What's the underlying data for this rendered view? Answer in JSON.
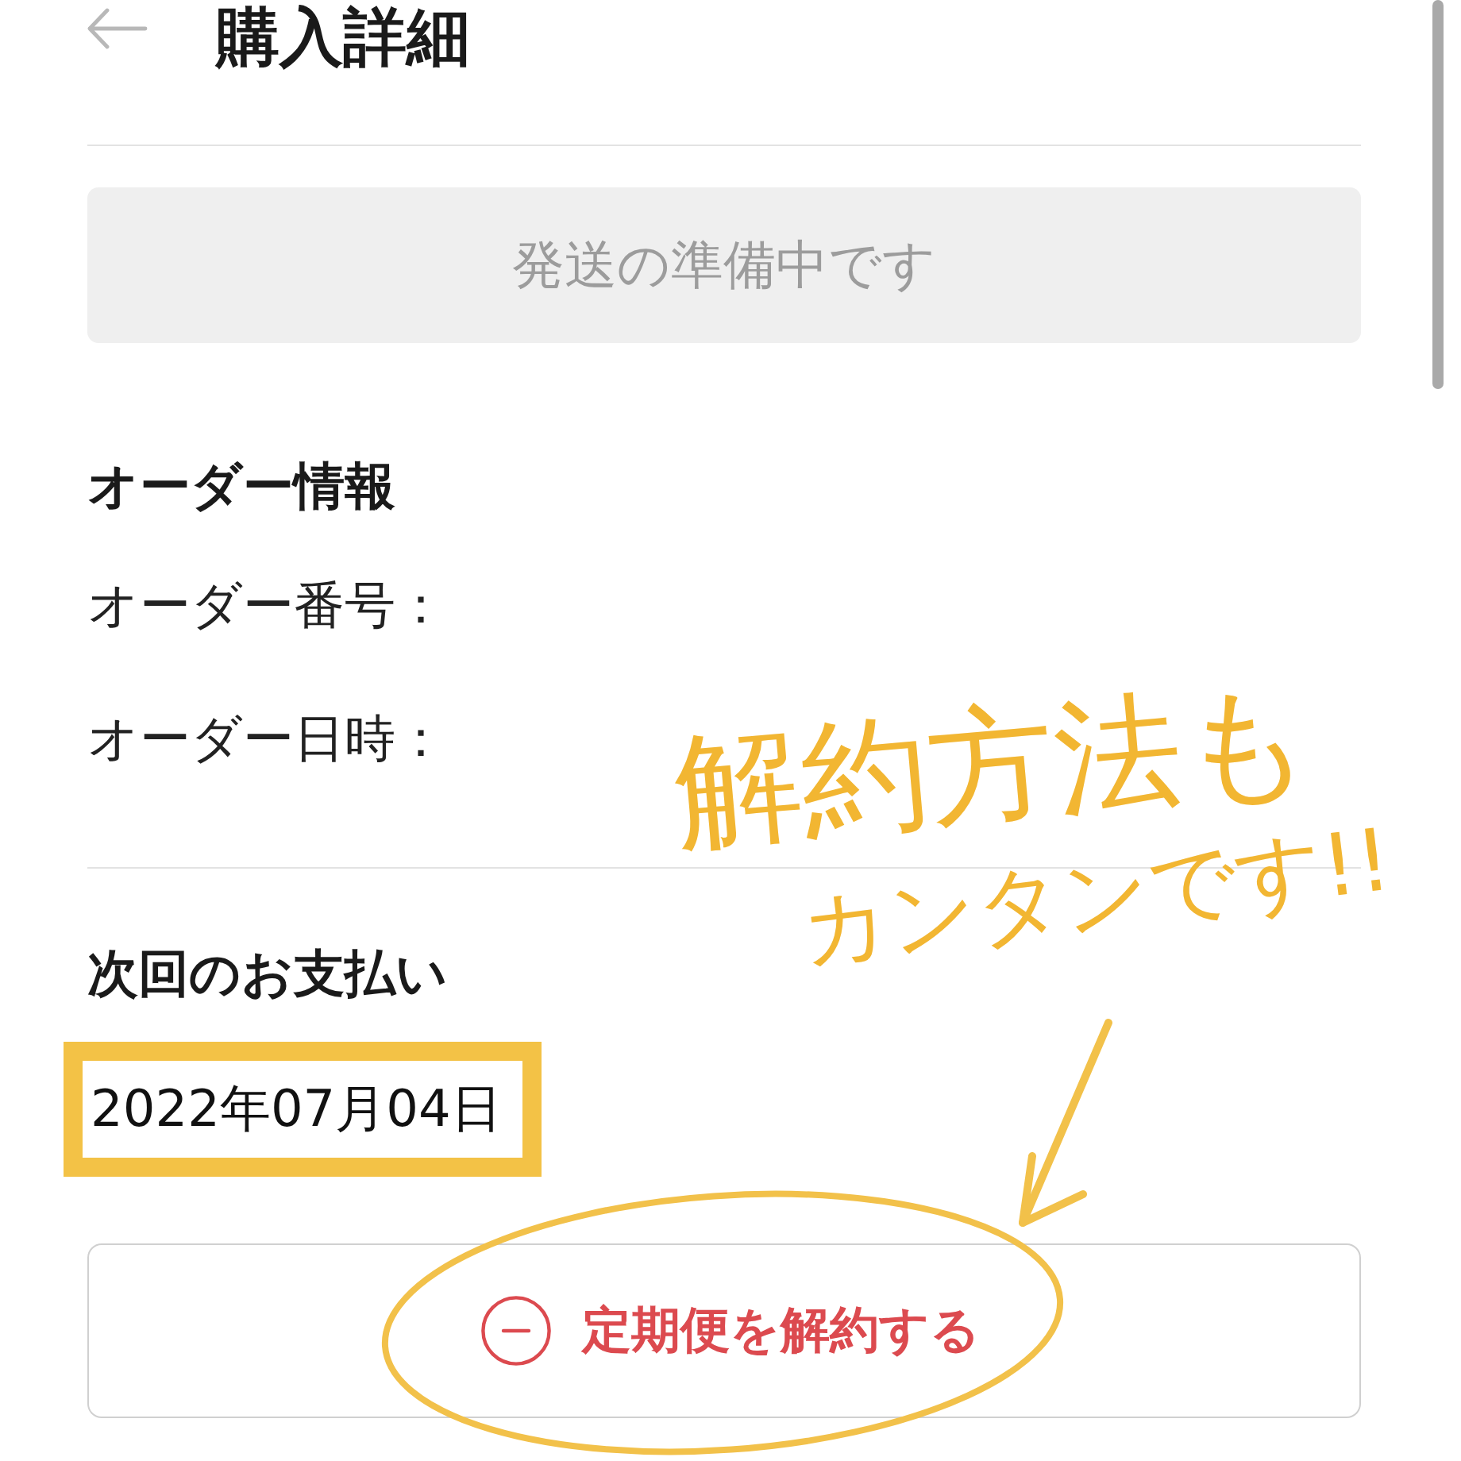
{
  "header": {
    "title": "購入詳細"
  },
  "status_banner": {
    "text": "発送の準備中です"
  },
  "order_info": {
    "heading": "オーダー情報",
    "rows": [
      {
        "label": "オーダー番号："
      },
      {
        "label": "オーダー日時："
      }
    ]
  },
  "next_payment": {
    "heading": "次回のお支払い",
    "date": "2022年07月04日",
    "highlighted": true
  },
  "cancel_button": {
    "label": "定期便を解約する",
    "circled": true
  },
  "annotation": {
    "lines": [
      "解約方法も",
      "カンタンです!!"
    ]
  }
}
